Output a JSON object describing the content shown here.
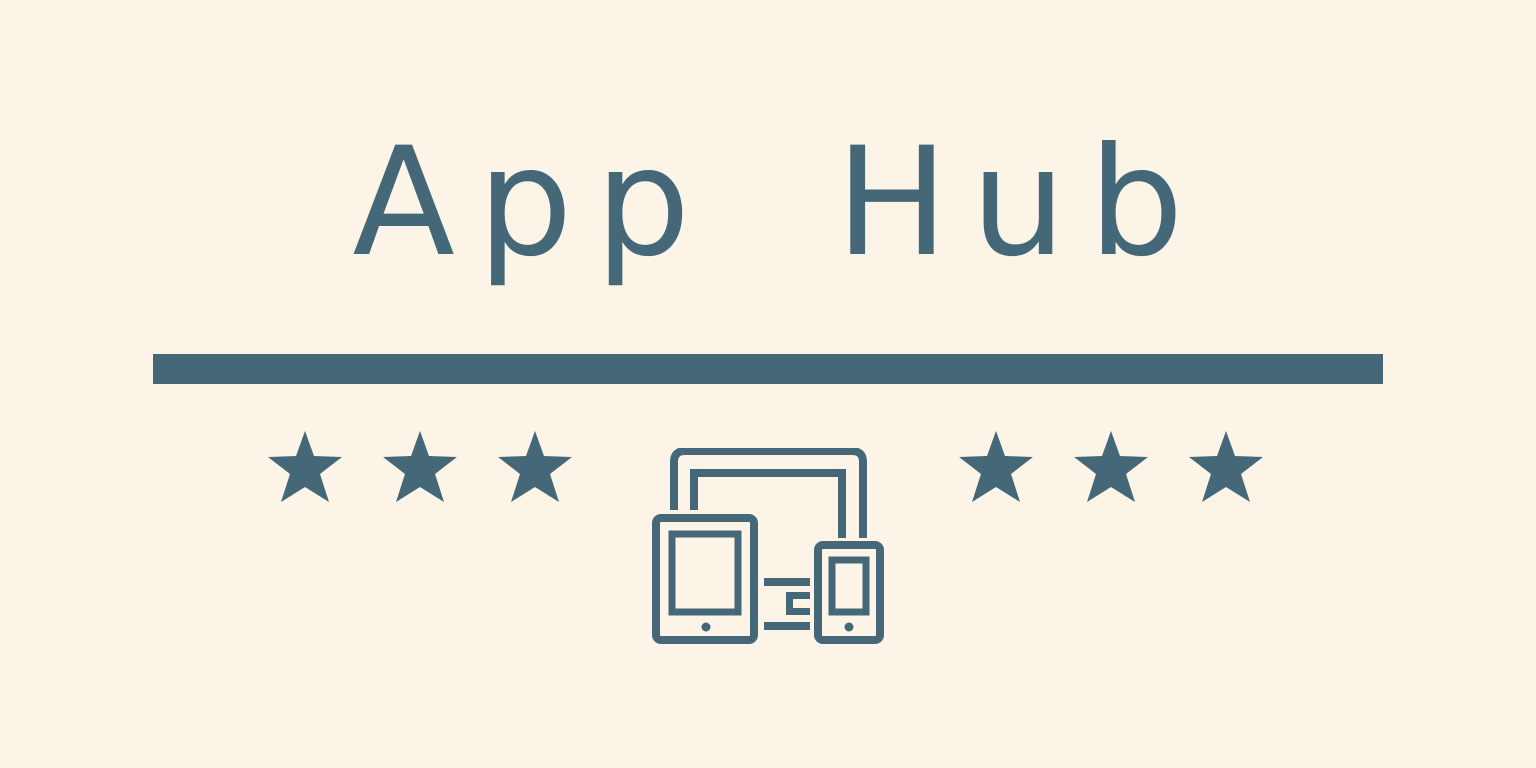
{
  "logo": {
    "title": "App Hub",
    "color": "#456879",
    "background": "#fdf4e8",
    "icons": {
      "left_stars": [
        "star-icon",
        "star-icon",
        "star-icon"
      ],
      "center": "devices-icon",
      "right_stars": [
        "star-icon",
        "star-icon",
        "star-icon"
      ]
    }
  }
}
